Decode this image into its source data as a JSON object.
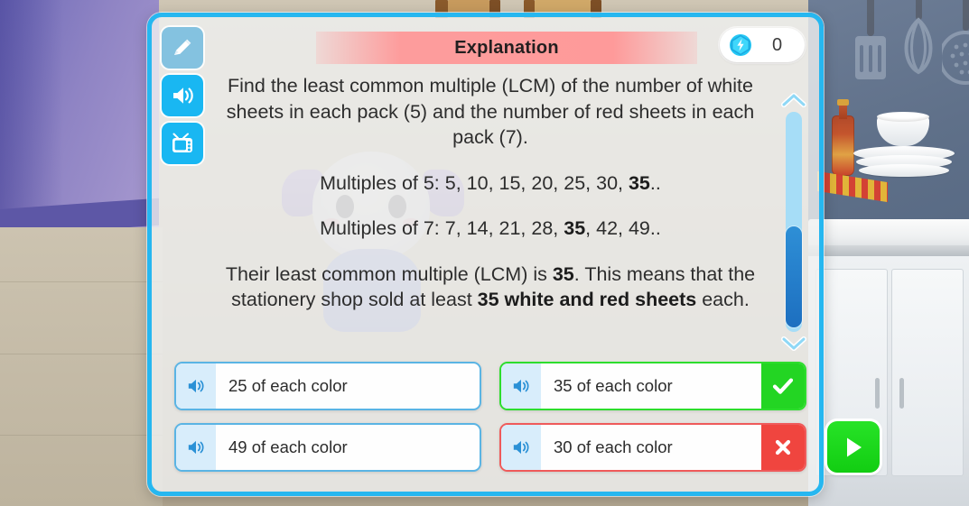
{
  "modal": {
    "title": "Explanation",
    "gem": {
      "icon": "gem-icon",
      "count": "0"
    },
    "tools": [
      {
        "name": "pencil-icon",
        "label": "Draw"
      },
      {
        "name": "speaker-icon",
        "label": "Read aloud"
      },
      {
        "name": "tv-icon",
        "label": "Watch video"
      }
    ],
    "explanation": {
      "p1_a": "Find the least common multiple (LCM) of the number of white sheets in each pack (5) and the number of red sheets in each pack (7).",
      "p2_a": "Multiples of 5: 5, 10, 15, 20, 25, 30, ",
      "p2_b": "35",
      "p2_c": "..",
      "p3_a": "Multiples of 7: 7, 14, 21, 28, ",
      "p3_b": "35",
      "p3_c": ", 42, 49..",
      "p4_a": "Their least common multiple (LCM) is ",
      "p4_b": "35",
      "p4_c": ". This means that the stationery shop sold at least ",
      "p4_d": "35 white and red sheets",
      "p4_e": " each."
    },
    "scrollbar": {
      "up": "chevron-up-icon",
      "down": "chevron-down-icon",
      "thumb": "scroll-thumb"
    },
    "options": [
      {
        "label": "25 of each color",
        "state": "neutral"
      },
      {
        "label": "35 of each color",
        "state": "correct"
      },
      {
        "label": "49 of each color",
        "state": "neutral"
      },
      {
        "label": "30 of each color",
        "state": "wrong"
      }
    ]
  },
  "continue_button": {
    "name": "play-icon",
    "label": "Continue"
  },
  "colors": {
    "modal_border": "#26b7f0",
    "title_banner": "#ff9696",
    "tool_active": "#19b7f2",
    "tool_disabled": "#84c2e0",
    "option_border": "#5ab4e4",
    "correct": "#23d523",
    "wrong": "#f0453f",
    "play": "#12cd12",
    "scroll_track": "#a6ddf7",
    "scroll_thumb": "#1d6fc0"
  }
}
